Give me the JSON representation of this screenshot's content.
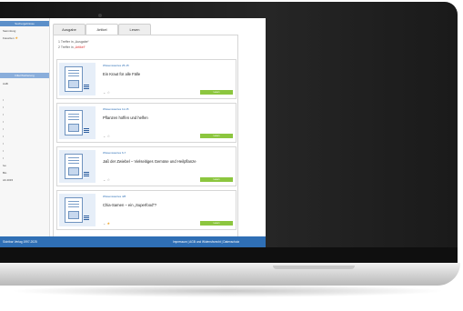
{
  "sidebar": {
    "header_top": "Suchergebnisse",
    "items": [
      "Sammlung",
      "Favoriten"
    ],
    "header_mid": "Filter/Sortierung",
    "filter_items": [
      "Aufb",
      "l",
      "l",
      "l",
      "l",
      "l",
      "l",
      "l",
      "l",
      "l",
      "ive",
      "Bio",
      "Ab 2015"
    ]
  },
  "tabs": [
    "Ausgabe",
    "Artikel",
    "Lesen"
  ],
  "active_tab": "Artikel",
  "hits": {
    "line1": "1 Treffer in „Ausgabe“",
    "line2_prefix": "2 Treffer in ",
    "line2_highlight": "„Artikel“"
  },
  "articles": [
    {
      "issue": "Wissenswertes 25-15",
      "title": "Ein Kraut für alle Fälle",
      "button": "Lesen",
      "favorite": false
    },
    {
      "issue": "Wissenswertes 11-15",
      "title": "Pflanzen hoffen und helfen",
      "button": "Lesen",
      "favorite": false
    },
    {
      "issue": "Wissenswertes 6-7",
      "title": "Jaß der Zwiebel – Vielseitiges Gemüse und Heilpflanze",
      "button": "Lesen",
      "favorite": false
    },
    {
      "issue": "Wissenswertes 4/8",
      "title": "Chia-Samen – ein „Superfood“?",
      "button": "Lesen",
      "favorite": true
    }
  ],
  "footer": {
    "left": "Sichtbar Verlag 1997-2025",
    "right": "Impressum | AGB und Widerrufsrecht | Datenschutz"
  },
  "colors": {
    "accent": "#2f6fb5",
    "button": "#8cc63f",
    "star": "#f0a52b"
  }
}
